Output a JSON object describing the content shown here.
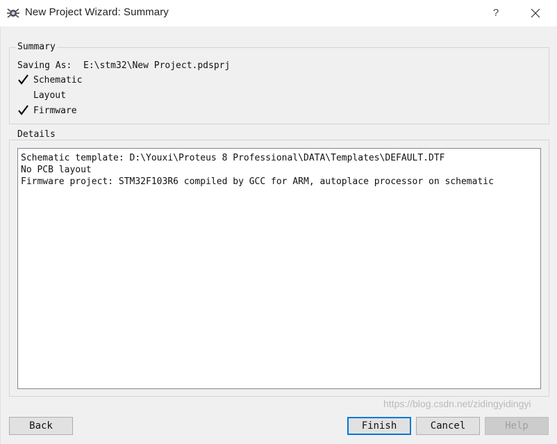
{
  "window": {
    "title": "New Project Wizard: Summary",
    "help_glyph": "?",
    "close_glyph": "×"
  },
  "summary": {
    "legend": "Summary",
    "saving_label": "Saving As:",
    "saving_path": "E:\\stm32\\New Project.pdsprj",
    "items": [
      {
        "label": "Schematic",
        "checked": true
      },
      {
        "label": "Layout",
        "checked": false
      },
      {
        "label": "Firmware",
        "checked": true
      }
    ]
  },
  "details": {
    "legend": "Details",
    "lines": [
      "Schematic template: D:\\Youxi\\Proteus 8 Professional\\DATA\\Templates\\DEFAULT.DTF",
      "No PCB layout",
      "Firmware project: STM32F103R6 compiled by GCC for ARM, autoplace processor on schematic"
    ]
  },
  "buttons": {
    "back": "Back",
    "finish": "Finish",
    "cancel": "Cancel",
    "help": "Help"
  },
  "watermark": "https://blog.csdn.net/zidingyidingyi",
  "colors": {
    "client_bg": "#f0f0f0",
    "default_button_border": "#0078d7",
    "check": "#000000"
  },
  "icons": {
    "app": "proteus-app-icon",
    "check": "check-icon",
    "close": "close-icon"
  }
}
